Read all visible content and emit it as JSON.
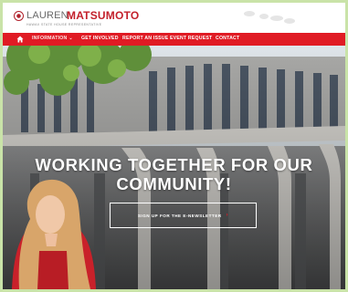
{
  "header": {
    "logo_first": "LAUREN",
    "logo_last": "MATSUMOTO",
    "logo_tagline": "HAWAII STATE HOUSE REPRESENTATIVE"
  },
  "nav": {
    "items": [
      {
        "label": "INFORMATION"
      },
      {
        "label": "GET INVOLVED"
      },
      {
        "label": "REPORT AN ISSUE"
      },
      {
        "label": "EVENT REQUEST"
      },
      {
        "label": "CONTACT"
      }
    ]
  },
  "hero": {
    "title_line1": "WORKING TOGETHER FOR OUR",
    "title_line2": "COMMUNITY!",
    "cta_label": "SIGN UP FOR THE E-NEWSLETTER",
    "cta_arrow": "›"
  },
  "colors": {
    "brand_red": "#e01b24",
    "logo_red": "#c3202b",
    "outer_border": "#c9e3a8"
  },
  "icons": {
    "home": "home-icon",
    "dropdown": "chevron-down-icon",
    "cta_arrow": "chevron-right-icon",
    "logo": "seal-icon"
  }
}
